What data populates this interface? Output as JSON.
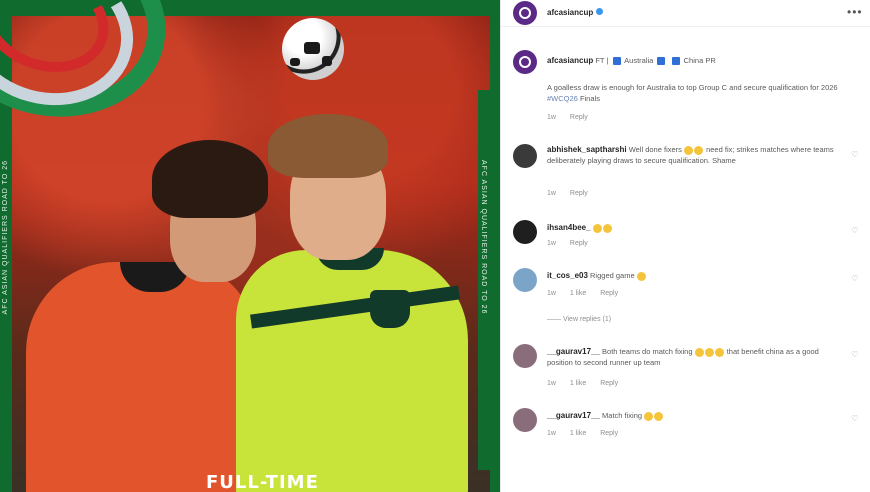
{
  "post": {
    "account": "afcasiancup",
    "caption_line1_pre": "FT |",
    "team_home": "Australia",
    "team_away": "China PR",
    "caption_body": "A goalless draw is enough for Australia to top Group C and secure qualification for 2026",
    "caption_hashtag": "#WCQ26",
    "caption_end": "Finals",
    "caption_meta_time": "1w",
    "caption_meta_action": "Reply",
    "image_text": "FULL-TIME",
    "side_text": "AFC ASIAN QUALIFIERS ROAD TO 26"
  },
  "comments": [
    {
      "user": "abhishek_saptharshi",
      "text": "Well done fixers",
      "emoji_count": 2,
      "text2": "need fix; strikes matches where teams deliberately playing draws to secure qualification. Shame",
      "time": "1w",
      "likes": "",
      "reply": "Reply",
      "avatar_color": "#3a3a3a"
    },
    {
      "user": "ihsan4bee_",
      "text": "",
      "emoji_count": 2,
      "text2": "",
      "time": "1w",
      "likes": "",
      "reply": "Reply",
      "avatar_color": "#1f1f1f"
    },
    {
      "user": "it_cos_e03",
      "text": "Rigged game",
      "emoji_count": 1,
      "text2": "",
      "time": "1w",
      "likes": "1 like",
      "reply": "Reply",
      "avatar_color": "#7aa4c8",
      "view_replies": "View replies (1)"
    },
    {
      "user": "__gaurav17__",
      "text": "Both teams do match fixing",
      "emoji_count": 3,
      "text2": "that benefit china as a good position to second runner up team",
      "time": "1w",
      "likes": "1 like",
      "reply": "Reply",
      "avatar_color": "#8a6d7a"
    },
    {
      "user": "__gaurav17__",
      "text": "Match fixing",
      "emoji_count": 2,
      "text2": "",
      "time": "1w",
      "likes": "1 like",
      "reply": "Reply",
      "avatar_color": "#8a6d7a"
    }
  ],
  "colors": {
    "brand": "#5b2a86",
    "verify": "#3897f0",
    "hashtag": "#6a83b5"
  },
  "icons": [
    "more-options-icon",
    "verified-badge-icon",
    "heart-icon",
    "flag-icon"
  ]
}
